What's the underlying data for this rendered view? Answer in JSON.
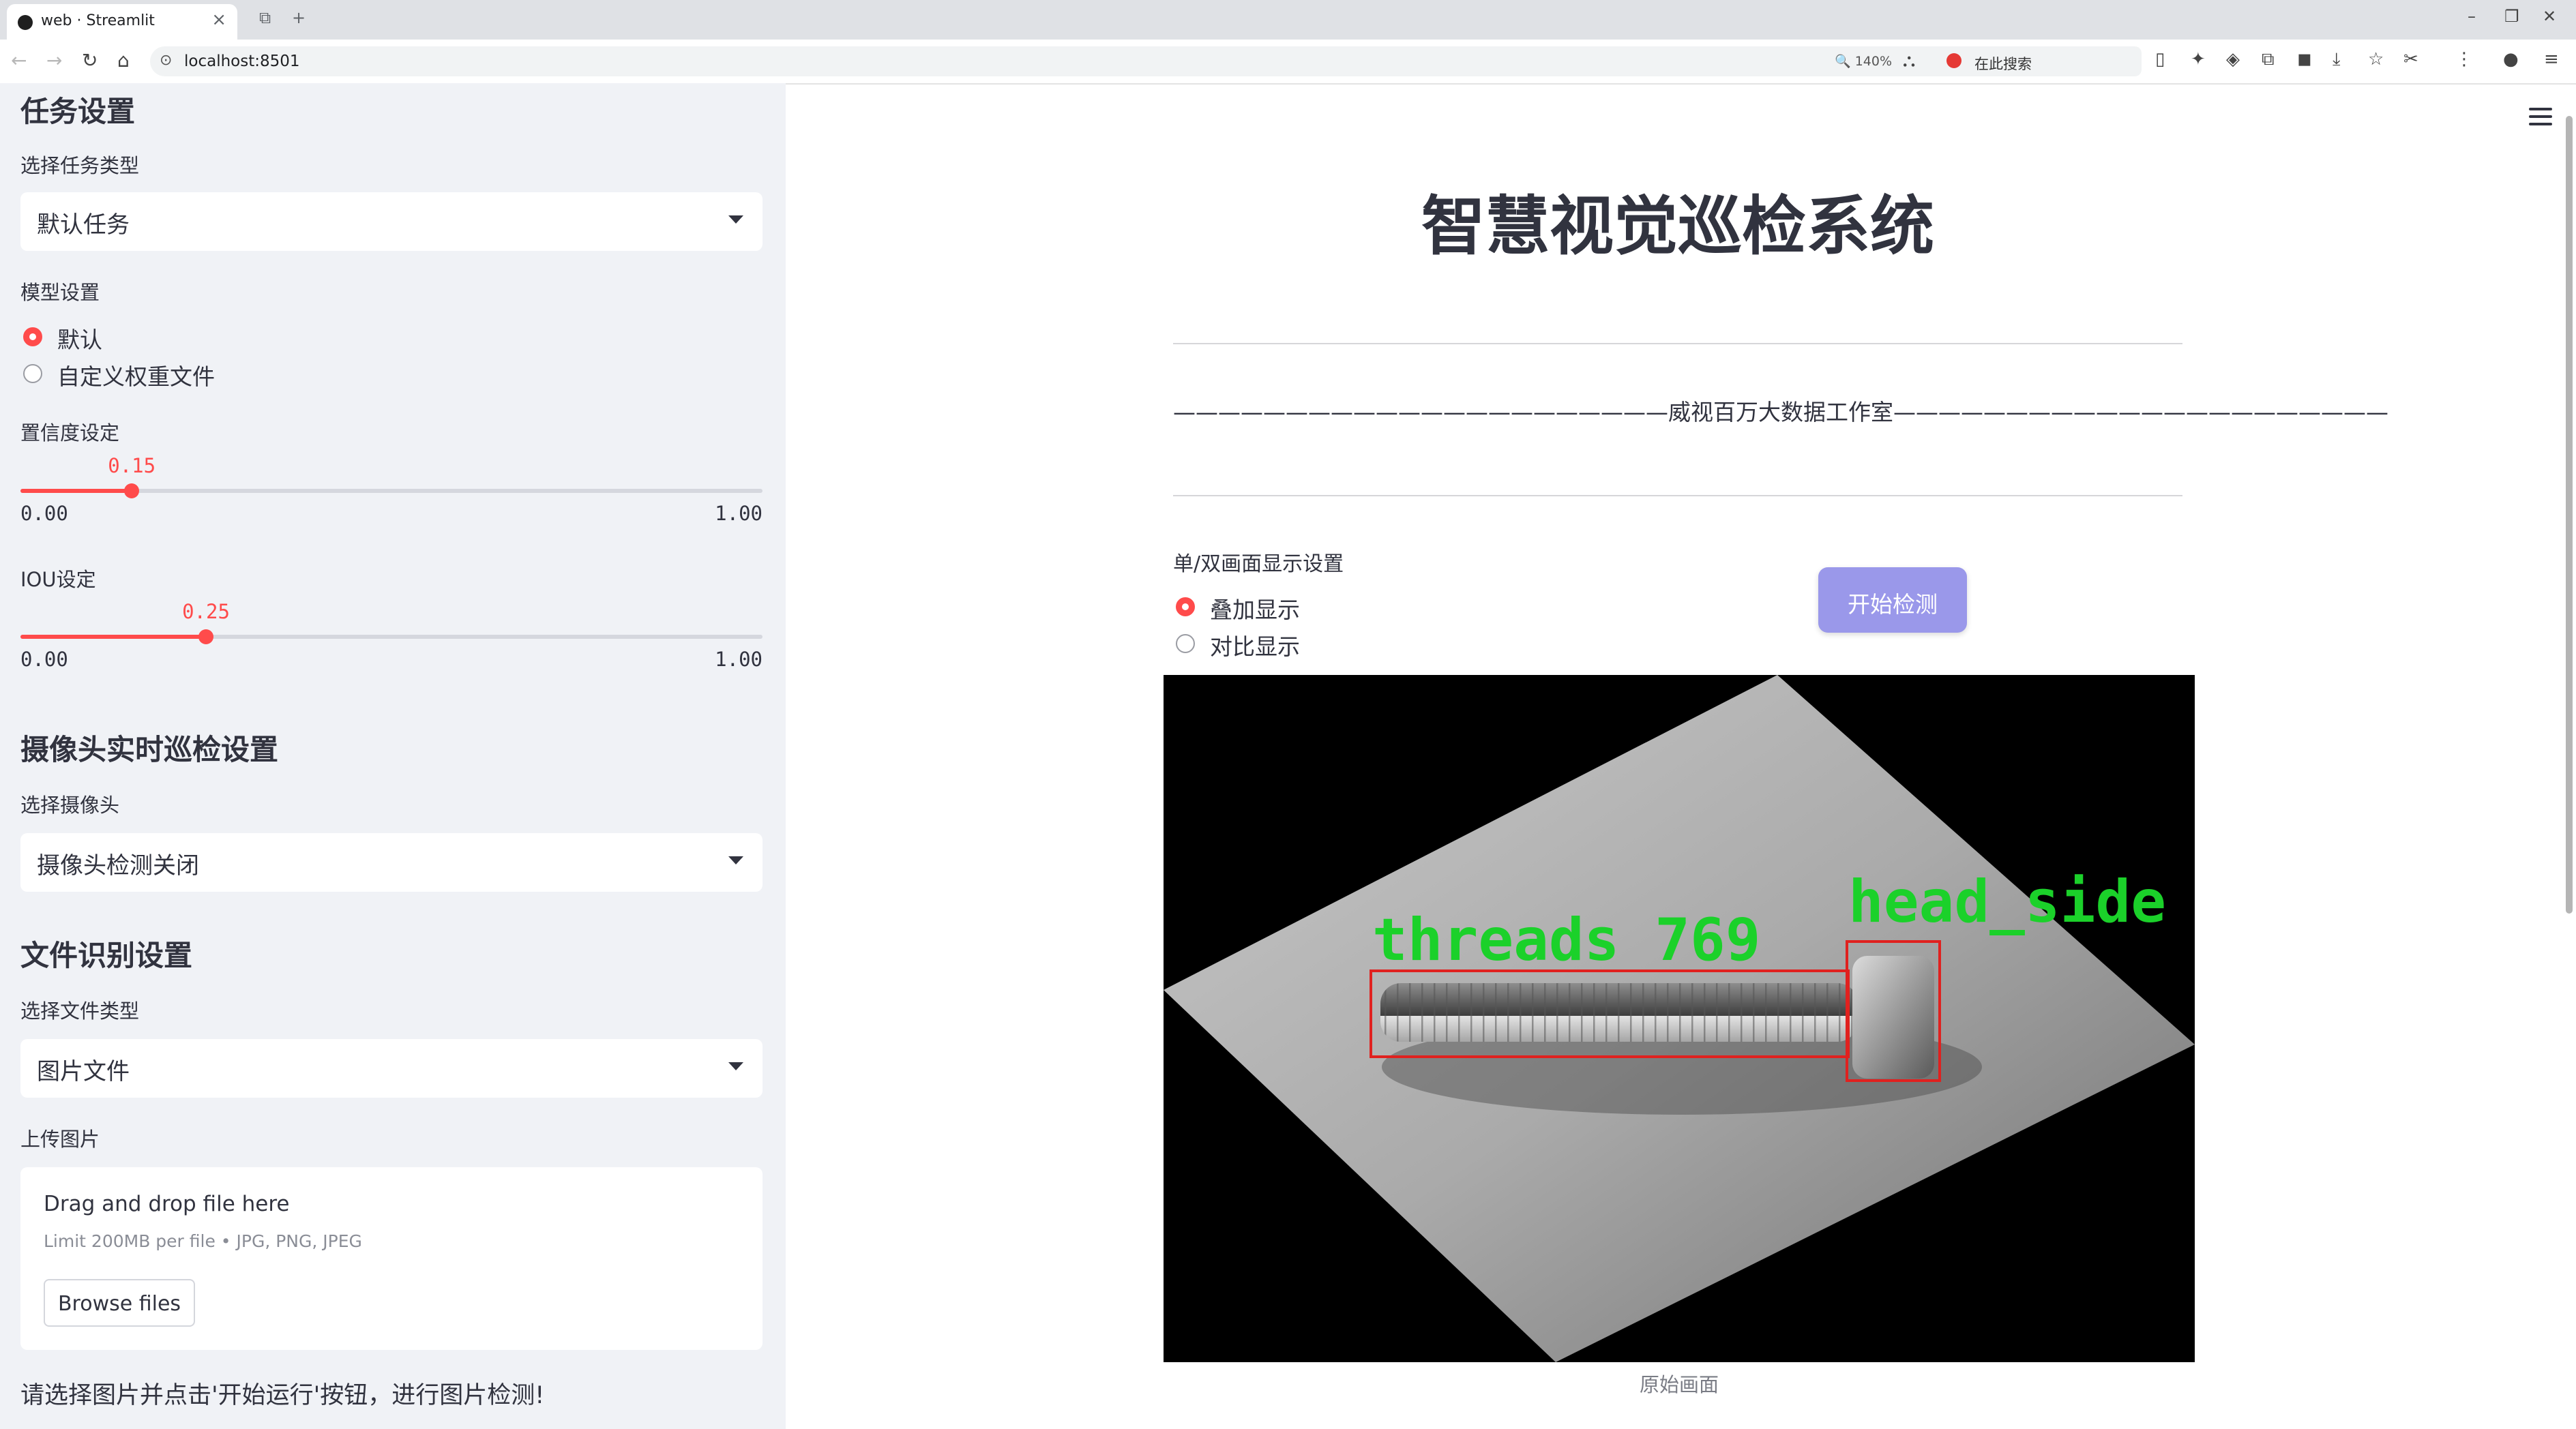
{
  "browser": {
    "tab_title": "web · Streamlit",
    "url": "localhost:8501",
    "zoom": "140%",
    "search_placeholder": "在此搜索"
  },
  "sidebar": {
    "task_section": {
      "heading": "任务设置",
      "task_type_label": "选择任务类型",
      "task_type_value": "默认任务",
      "model_label": "模型设置",
      "model_options": [
        "默认",
        "自定义权重文件"
      ],
      "model_selected": "默认"
    },
    "confidence": {
      "label": "置信度设定",
      "value": "0.15",
      "value_num": 0.15,
      "min": "0.00",
      "max": "1.00"
    },
    "iou": {
      "label": "IOU设定",
      "value": "0.25",
      "value_num": 0.25,
      "min": "0.00",
      "max": "1.00"
    },
    "camera_section": {
      "heading": "摄像头实时巡检设置",
      "camera_label": "选择摄像头",
      "camera_value": "摄像头检测关闭"
    },
    "file_section": {
      "heading": "文件识别设置",
      "file_type_label": "选择文件类型",
      "file_type_value": "图片文件",
      "upload_label": "上传图片",
      "drop_text": "Drag and drop file here",
      "limit_text": "Limit 200MB per file • JPG, PNG, JPEG",
      "browse_label": "Browse files"
    },
    "instruction": "请选择图片并点击'开始运行'按钮，进行图片检测!"
  },
  "main": {
    "title": "智慧视觉巡检系统",
    "subtitle": "——————————————————————威视百万大数据工作室——————————————————————",
    "display_label": "单/双画面显示设置",
    "display_options": [
      "叠加显示",
      "对比显示"
    ],
    "display_selected": "叠加显示",
    "start_button": "开始检测",
    "image_caption": "原始画面",
    "detections": [
      {
        "label": "threads 769",
        "color": "#e0211f",
        "text_color": "#1bd12a"
      },
      {
        "label": "head_side",
        "color": "#e0211f",
        "text_color": "#1bd12a"
      }
    ]
  },
  "colors": {
    "accent": "#ff4b4b",
    "sidebar_bg": "#f0f2f6",
    "button_primary": "#9a98ea",
    "text": "#31333f"
  }
}
